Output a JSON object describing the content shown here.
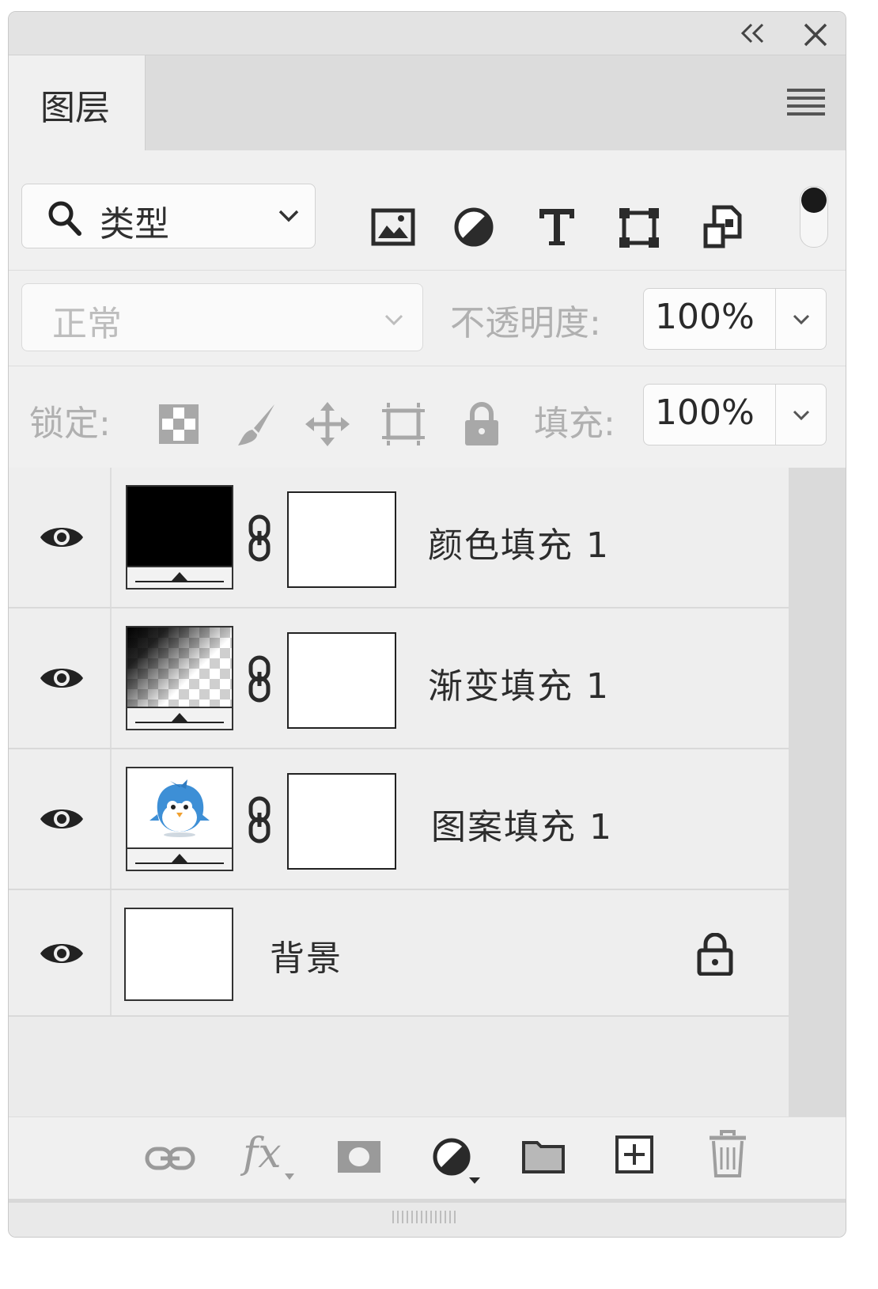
{
  "panel": {
    "tab_label": "图层",
    "titlebar": {
      "collapse_icon": "double-chevron-left-icon",
      "close_icon": "close-icon"
    },
    "menu_icon": "hamburger-menu-icon"
  },
  "filter": {
    "kind_label": "类型",
    "search_icon": "search-icon",
    "filter_icons": [
      "image-filter-icon",
      "adjustment-filter-icon",
      "type-filter-icon",
      "shape-filter-icon",
      "smart-object-filter-icon"
    ],
    "toggle_state": "on"
  },
  "blend": {
    "mode": "正常",
    "opacity_label": "不透明度:",
    "opacity_value": "100%"
  },
  "lock": {
    "label": "锁定:",
    "icons": [
      "lock-transparent-pixels-icon",
      "lock-image-pixels-icon",
      "lock-position-icon",
      "lock-artboard-icon",
      "lock-all-icon"
    ],
    "fill_label": "填充:",
    "fill_value": "100%"
  },
  "layers": [
    {
      "name": "颜色填充 1",
      "visible": true,
      "thumb": "solid-black",
      "has_mask": true
    },
    {
      "name": "渐变填充 1",
      "visible": true,
      "thumb": "gradient",
      "has_mask": true
    },
    {
      "name": "图案填充 1",
      "visible": true,
      "thumb": "pattern",
      "has_mask": true
    },
    {
      "name": "背景",
      "visible": true,
      "thumb": "white",
      "locked": true
    }
  ],
  "footer": {
    "fx_label": "fx",
    "buttons": [
      "link-layers-icon",
      "layer-style-icon",
      "add-mask-icon",
      "new-adjustment-layer-icon",
      "new-group-icon",
      "new-layer-icon",
      "delete-layer-icon"
    ]
  },
  "colors": {
    "panel_bg": "#f0f0f0",
    "tab_bar_bg": "#dcdcdc",
    "text_disabled": "#b0b0b0"
  }
}
